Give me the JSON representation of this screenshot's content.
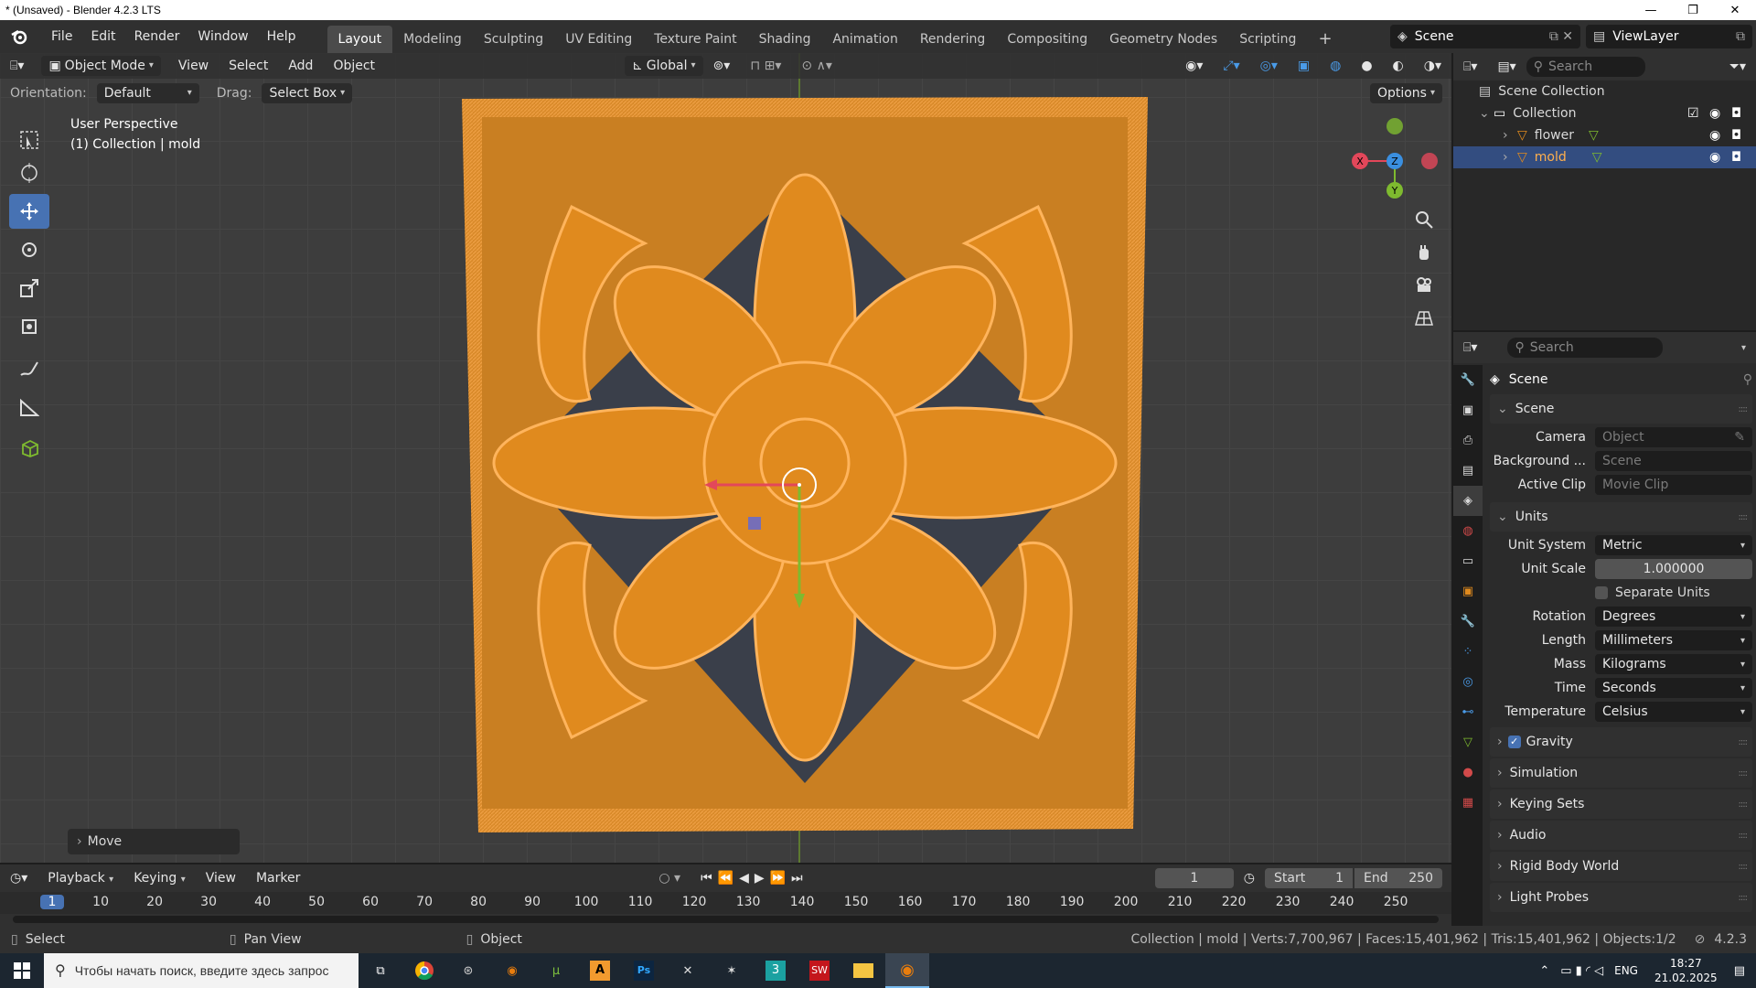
{
  "window": {
    "title": "* (Unsaved) - Blender 4.2.3 LTS",
    "minimize": "—",
    "maximize": "❐",
    "close": "✕"
  },
  "menu": [
    "File",
    "Edit",
    "Render",
    "Window",
    "Help"
  ],
  "workspaces": [
    "Layout",
    "Modeling",
    "Sculpting",
    "UV Editing",
    "Texture Paint",
    "Shading",
    "Animation",
    "Rendering",
    "Compositing",
    "Geometry Nodes",
    "Scripting"
  ],
  "active_workspace": "Layout",
  "scene_name": "Scene",
  "view_layer": "ViewLayer",
  "viewport": {
    "mode": "Object Mode",
    "header_menu": [
      "View",
      "Select",
      "Add",
      "Object"
    ],
    "transform_orientation": "Global",
    "orientation_label": "Orientation:",
    "orientation_value": "Default",
    "drag_label": "Drag:",
    "drag_value": "Select Box",
    "options": "Options",
    "perspective": "User Perspective",
    "collection_info": "(1) Collection | mold",
    "last_op": "Move",
    "gizmo": {
      "x": "X",
      "y": "Y",
      "z": "Z"
    },
    "colors": {
      "object": "#e08a1e",
      "selection": "#ffa64d",
      "x": "#e3475a",
      "y": "#7eba2f",
      "z": "#3a8fe0"
    }
  },
  "outliner": {
    "search_placeholder": "Search",
    "root": "Scene Collection",
    "collection": "Collection",
    "items": [
      "flower",
      "mold"
    ],
    "selected": "mold"
  },
  "properties": {
    "search_placeholder": "Search",
    "context": "Scene",
    "scene_panel": {
      "title": "Scene",
      "camera_label": "Camera",
      "camera_placeholder": "Object",
      "background_label": "Background ...",
      "background_placeholder": "Scene",
      "clip_label": "Active Clip",
      "clip_placeholder": "Movie Clip"
    },
    "units_panel": {
      "title": "Units",
      "unit_system_label": "Unit System",
      "unit_system": "Metric",
      "unit_scale_label": "Unit Scale",
      "unit_scale": "1.000000",
      "separate_units": "Separate Units",
      "rotation_label": "Rotation",
      "rotation": "Degrees",
      "length_label": "Length",
      "length": "Millimeters",
      "mass_label": "Mass",
      "mass": "Kilograms",
      "time_label": "Time",
      "time": "Seconds",
      "temperature_label": "Temperature",
      "temperature": "Celsius"
    },
    "collapsed": [
      "Gravity",
      "Simulation",
      "Keying Sets",
      "Audio",
      "Rigid Body World",
      "Light Probes"
    ]
  },
  "timeline": {
    "menu": [
      "Playback",
      "Keying",
      "View",
      "Marker"
    ],
    "current_frame": "1",
    "start_label": "Start",
    "start": "1",
    "end_label": "End",
    "end": "250",
    "ticks": [
      "1",
      "10",
      "20",
      "30",
      "40",
      "50",
      "60",
      "70",
      "80",
      "90",
      "100",
      "110",
      "120",
      "130",
      "140",
      "150",
      "160",
      "170",
      "180",
      "190",
      "200",
      "210",
      "220",
      "230",
      "240",
      "250"
    ]
  },
  "statusbar": {
    "select": "Select",
    "pan": "Pan View",
    "object": "Object",
    "stats": "Collection | mold | Verts:7,700,967 | Faces:15,401,962 | Tris:15,401,962 | Objects:1/2",
    "version": "4.2.3"
  },
  "taskbar": {
    "search_placeholder": "Чтобы начать поиск, введите здесь запрос",
    "lang": "ENG",
    "time": "18:27",
    "date": "21.02.2025"
  }
}
